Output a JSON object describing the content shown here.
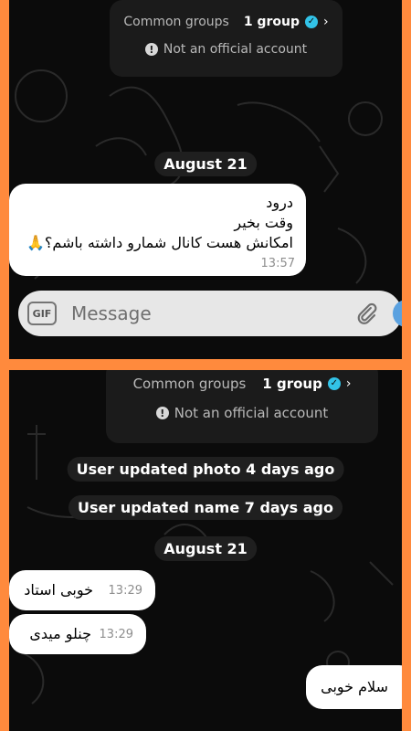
{
  "screenshot_top": {
    "header": {
      "common_groups_label": "Common groups",
      "common_groups_value": "1 group",
      "not_official": "Not an official account"
    },
    "date_pill": "August 21",
    "message": {
      "lines": [
        "درود",
        "وقت بخیر",
        "امکانش هست کانال شمارو داشته باشم؟🙏"
      ],
      "time": "13:57"
    },
    "composer": {
      "gif_label": "GIF",
      "placeholder": "Message"
    }
  },
  "screenshot_bottom": {
    "header": {
      "common_groups_label": "Common groups",
      "common_groups_value": "1 group",
      "not_official": "Not an official account"
    },
    "events": [
      "User updated photo 4 days ago",
      "User updated name 7 days ago"
    ],
    "date_pill": "August 21",
    "messages": [
      {
        "text": "خوبی استاد",
        "time": "13:29"
      },
      {
        "text": "چنلو میدی",
        "time": "13:29"
      },
      {
        "text": "سلام خوبی",
        "time": ""
      }
    ]
  },
  "colors": {
    "frame": "#ff8a3d",
    "chat_bg": "#0b0b0b",
    "bubble": "#ffffff",
    "pill_bg": "#1f1f1f",
    "verified": "#32c3e8"
  }
}
